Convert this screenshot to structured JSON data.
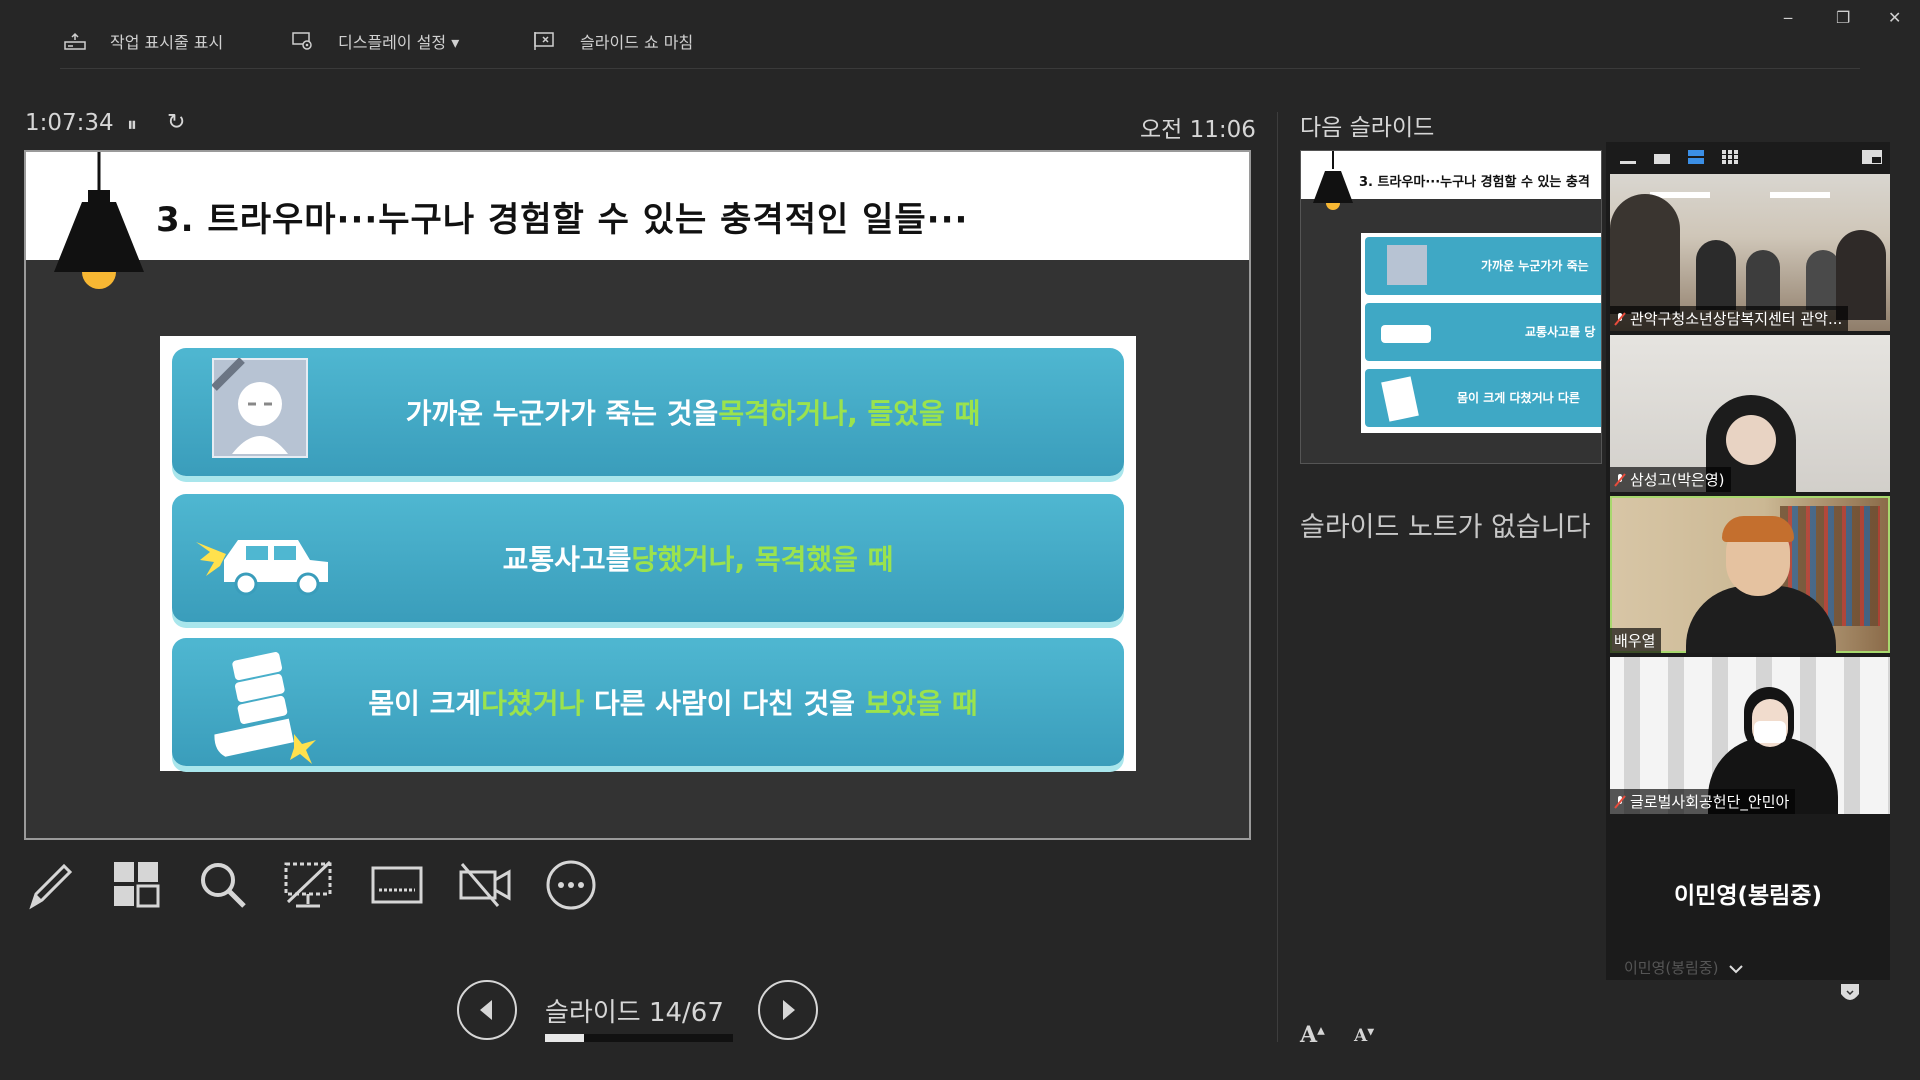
{
  "toolbar": {
    "taskbar_label": "작업 표시줄 표시",
    "display_label": "디스플레이 설정 ▾",
    "end_label": "슬라이드 쇼 마침"
  },
  "window_controls": {
    "minimize": "‒",
    "restore": "❐",
    "close": "✕"
  },
  "timer": {
    "elapsed": "1:07:34",
    "pause": "⏸",
    "reset": "↻"
  },
  "clock": "오전 11:06",
  "slide": {
    "title": "3. 트라우마···누구나 경험할 수 있는 충격적인 일들···",
    "cards": [
      {
        "normal": "가까운 누군가가 죽는 것을 ",
        "highlight": "목격하거나, 들었을 때",
        "tail": ""
      },
      {
        "normal": "교통사고를 ",
        "highlight": "당했거나, 목격했을 때",
        "tail": ""
      },
      {
        "normal": "몸이 크게 ",
        "highlight": "다쳤거나",
        "tail": " 다른 사람이 다친 것을 ",
        "highlight2": "보았을 때"
      }
    ]
  },
  "navigation": {
    "slide_counter": "슬라이드 14/67",
    "progress": 0.209
  },
  "tools": [
    "pen-icon",
    "grid-icon",
    "zoom-icon",
    "black-screen-icon",
    "subtitles-icon",
    "camera-off-icon",
    "more-icon"
  ],
  "next_slide": {
    "label": "다음 슬라이드",
    "thumb_title": "3. 트라우마···누구나 경험할 수 있는 충격",
    "rows": [
      "가까운 누군가가 죽는",
      "교통사고를 당",
      "몸이 크게 다쳤거나 다른"
    ]
  },
  "notes": {
    "text": "슬라이드 노트가 없습니다"
  },
  "font_controls": {
    "increase": "A",
    "decrease": "A"
  },
  "participants": [
    {
      "name": "관악구청소년상담복지센터 관악..."
    },
    {
      "name": "삼성고(박은영)"
    },
    {
      "name": "배우열"
    },
    {
      "name": "글로벌사회공헌단_안민아"
    }
  ],
  "speaker": {
    "name": "이민영(봉림중)"
  },
  "colors": {
    "card": "#3a9dbb",
    "highlight": "#9be34d",
    "background": "#262626"
  }
}
